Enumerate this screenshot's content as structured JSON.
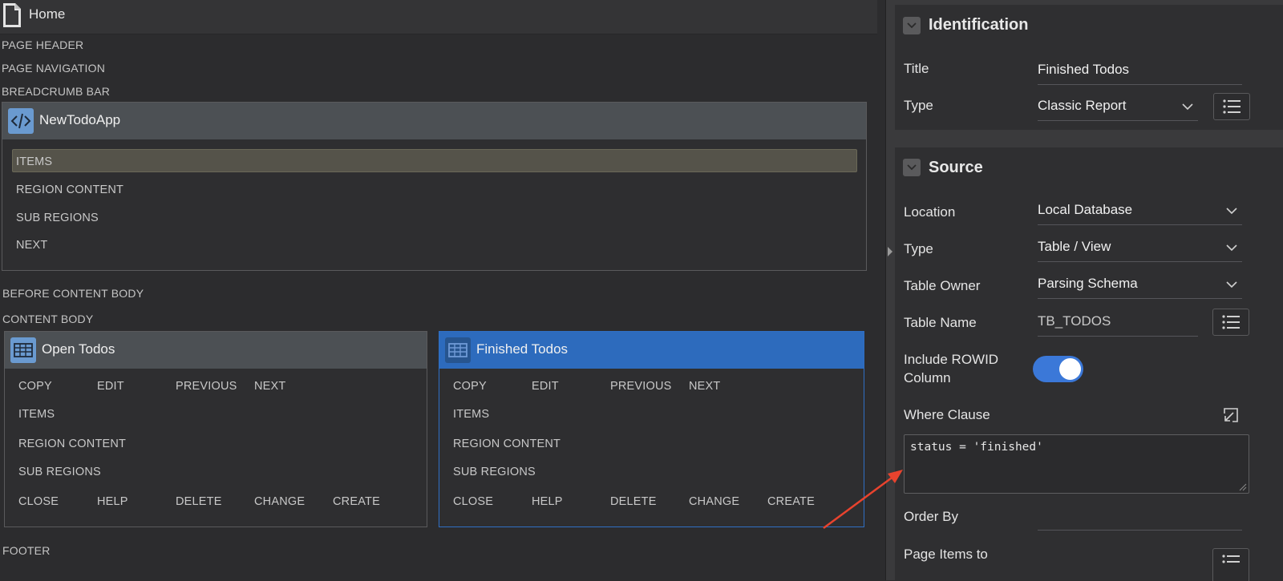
{
  "left": {
    "home_title": "Home",
    "positions": {
      "page_header": "PAGE HEADER",
      "page_navigation": "PAGE NAVIGATION",
      "breadcrumb_bar": "BREADCRUMB BAR",
      "before_content_body": "BEFORE CONTENT BODY",
      "content_body": "CONTENT BODY",
      "footer": "FOOTER"
    },
    "nav_region": {
      "title": "NewTodoApp",
      "items": [
        "ITEMS",
        "REGION CONTENT",
        "SUB REGIONS",
        "NEXT"
      ]
    },
    "open_region": {
      "title": "Open Todos",
      "row1": [
        "COPY",
        "EDIT",
        "PREVIOUS",
        "NEXT"
      ],
      "items": "ITEMS",
      "region_content": "REGION CONTENT",
      "sub_regions": "SUB REGIONS",
      "row2": [
        "CLOSE",
        "HELP",
        "DELETE",
        "CHANGE",
        "CREATE"
      ]
    },
    "finished_region": {
      "title": "Finished Todos",
      "row1": [
        "COPY",
        "EDIT",
        "PREVIOUS",
        "NEXT"
      ],
      "items": "ITEMS",
      "region_content": "REGION CONTENT",
      "sub_regions": "SUB REGIONS",
      "row2": [
        "CLOSE",
        "HELP",
        "DELETE",
        "CHANGE",
        "CREATE"
      ]
    }
  },
  "right": {
    "identification": {
      "heading": "Identification",
      "title_label": "Title",
      "title_value": "Finished Todos",
      "type_label": "Type",
      "type_value": "Classic Report"
    },
    "source": {
      "heading": "Source",
      "location_label": "Location",
      "location_value": "Local Database",
      "type_label": "Type",
      "type_value": "Table / View",
      "table_owner_label": "Table Owner",
      "table_owner_value": "Parsing Schema",
      "table_name_label": "Table Name",
      "table_name_value": "TB_TODOS",
      "include_rowid_label_1": "Include ROWID",
      "include_rowid_label_2": "Column",
      "include_rowid_on": true,
      "where_label": "Where Clause",
      "where_value": "status = 'finished'",
      "order_by_label": "Order By",
      "page_items_label": "Page Items to"
    }
  },
  "colors": {
    "accent_blue": "#3b78d8",
    "selected_region": "#2d6bbd",
    "annotation_arrow": "#e8432e"
  },
  "icons": [
    "document-icon",
    "code-icon",
    "table-icon",
    "chevron-down-icon",
    "list-icon",
    "expand-icon"
  ]
}
